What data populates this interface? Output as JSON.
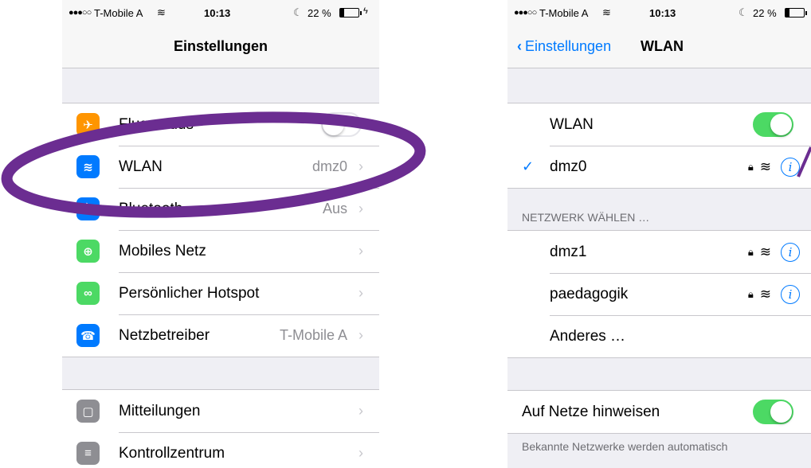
{
  "left": {
    "status": {
      "signal": "●●●○○",
      "carrier": "T-Mobile A",
      "time": "10:13",
      "battery": "22 %"
    },
    "nav_title": "Einstellungen",
    "group1": [
      {
        "label": "Flugmodus",
        "icon": "airplane-icon",
        "color": "#ff9500",
        "type": "toggle",
        "on": false
      },
      {
        "label": "WLAN",
        "icon": "wifi-icon",
        "color": "#007aff",
        "value": "dmz0",
        "type": "chevron"
      },
      {
        "label": "Bluetooth",
        "icon": "bluetooth-icon",
        "color": "#007aff",
        "value": "Aus",
        "type": "chevron"
      },
      {
        "label": "Mobiles Netz",
        "icon": "antenna-icon",
        "color": "#4cd964",
        "value": "",
        "type": "chevron"
      },
      {
        "label": "Persönlicher Hotspot",
        "icon": "hotspot-icon",
        "color": "#4cd964",
        "value": "",
        "type": "chevron"
      },
      {
        "label": "Netzbetreiber",
        "icon": "phone-icon",
        "color": "#007aff",
        "value": "T-Mobile A",
        "type": "chevron"
      }
    ],
    "group2": [
      {
        "label": "Mitteilungen",
        "icon": "notifications-icon",
        "color": "#8e8e93",
        "value": "",
        "type": "chevron"
      },
      {
        "label": "Kontrollzentrum",
        "icon": "control-center-icon",
        "color": "#8e8e93",
        "value": "",
        "type": "chevron"
      }
    ]
  },
  "right": {
    "status": {
      "signal": "●●●○○",
      "carrier": "T-Mobile A",
      "time": "10:13",
      "battery": "22 %"
    },
    "back_label": "Einstellungen",
    "nav_title": "WLAN",
    "wlan_label": "WLAN",
    "connected_network": "dmz0",
    "section_header": "NETZWERK WÄHLEN …",
    "networks": [
      "dmz1",
      "paedagogik"
    ],
    "other_label": "Anderes …",
    "ask_label": "Auf Netze hinweisen",
    "footer": "Bekannte Netzwerke werden automatisch"
  },
  "annotation_color": "#6b2d91"
}
